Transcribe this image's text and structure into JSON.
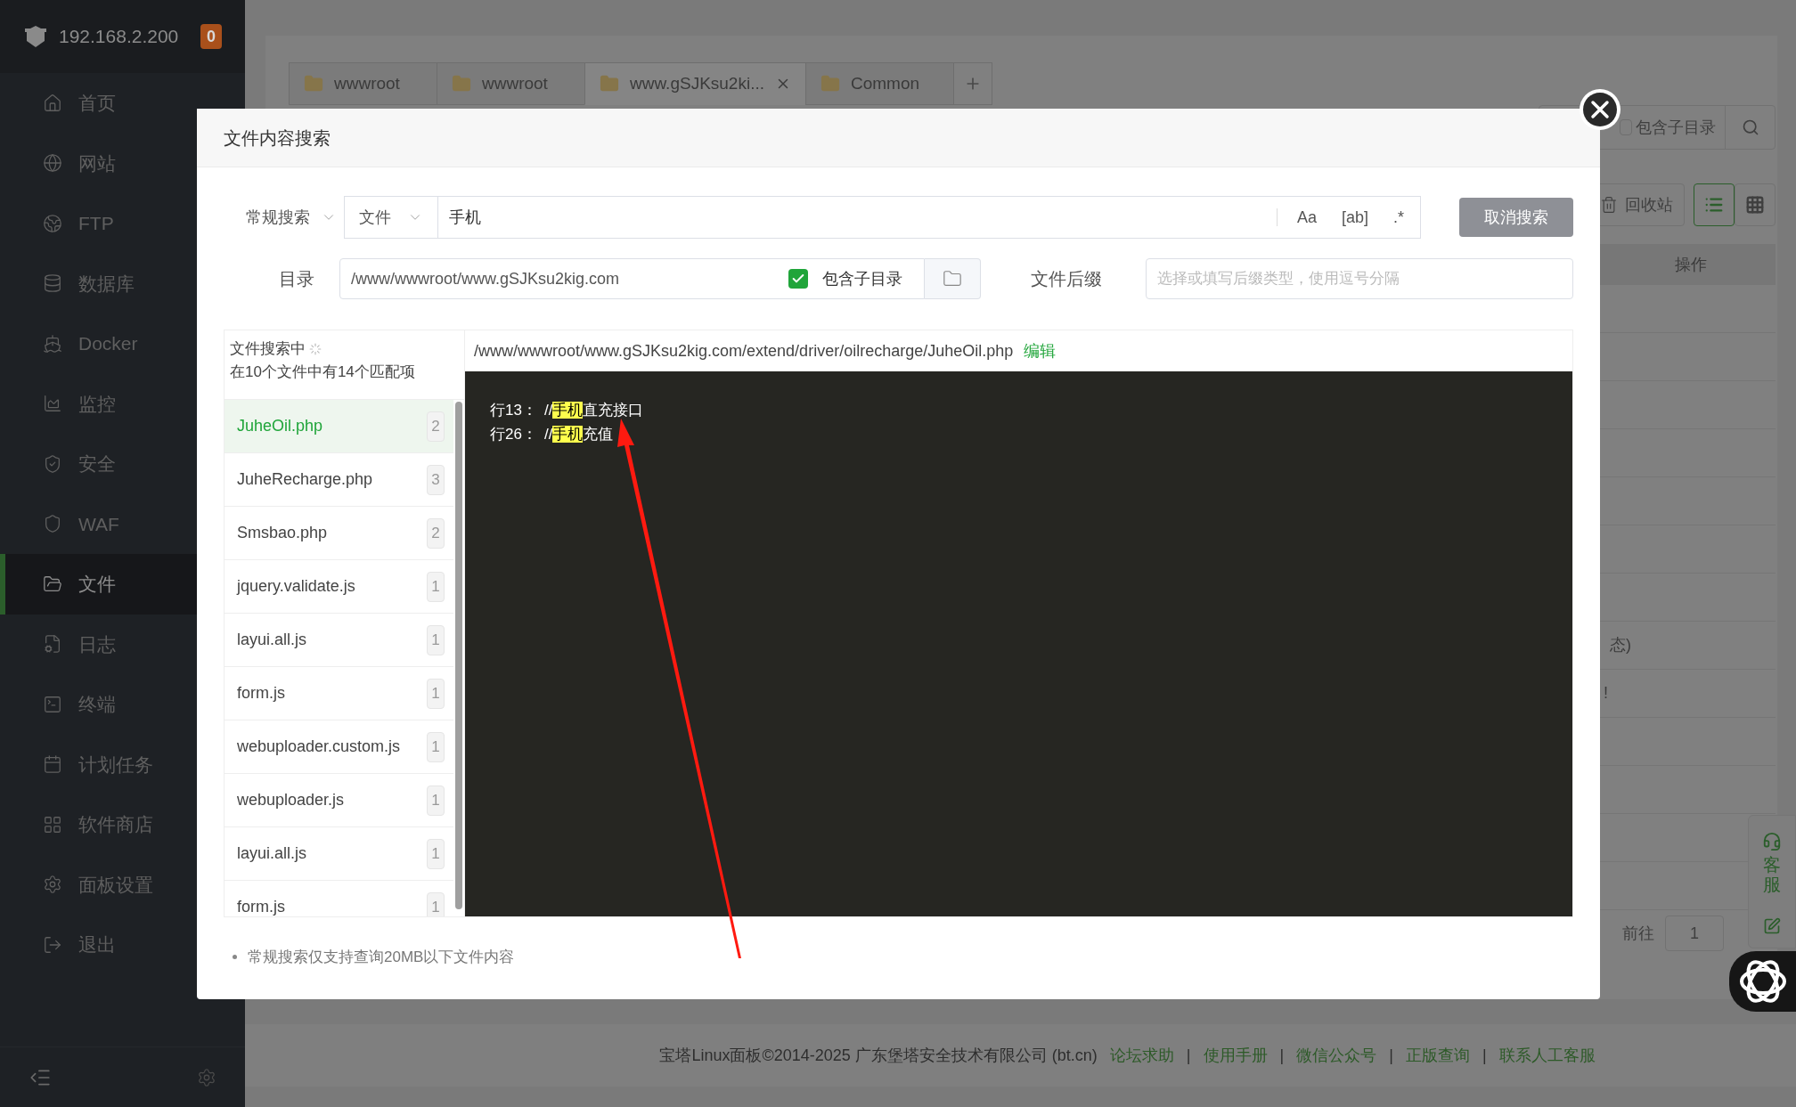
{
  "sidebar": {
    "host": "192.168.2.200",
    "badge": "0",
    "items": [
      {
        "label": "首页",
        "selected": false
      },
      {
        "label": "网站",
        "selected": false
      },
      {
        "label": "FTP",
        "selected": false
      },
      {
        "label": "数据库",
        "selected": false
      },
      {
        "label": "Docker",
        "selected": false
      },
      {
        "label": "监控",
        "selected": false
      },
      {
        "label": "安全",
        "selected": false
      },
      {
        "label": "WAF",
        "selected": false
      },
      {
        "label": "文件",
        "selected": true
      },
      {
        "label": "日志",
        "selected": false
      },
      {
        "label": "终端",
        "selected": false
      },
      {
        "label": "计划任务",
        "selected": false
      },
      {
        "label": "软件商店",
        "selected": false
      },
      {
        "label": "面板设置",
        "selected": false
      },
      {
        "label": "退出",
        "selected": false
      }
    ]
  },
  "tabs": [
    {
      "label": "wwwroot",
      "selected": false,
      "closable": false
    },
    {
      "label": "wwwroot",
      "selected": false,
      "closable": false
    },
    {
      "label": "www.gSJKsu2ki...",
      "selected": true,
      "closable": true
    },
    {
      "label": "Common",
      "selected": false,
      "closable": false
    }
  ],
  "toolbar": {
    "subdir_label": "包含子目录",
    "subdir_checked": false,
    "recycle_label": "回收站",
    "views": [
      {
        "kind": "list",
        "selected": true
      },
      {
        "kind": "grid",
        "selected": false
      }
    ]
  },
  "table": {
    "column_header": "操作",
    "fragments": [
      "态)",
      "!"
    ]
  },
  "pagination": {
    "goto_label": "前往",
    "page": "1"
  },
  "float_panel": {
    "label": "客服"
  },
  "footer": {
    "copyright": "宝塔Linux面板©2014-2025 广东堡塔安全技术有限公司 (bt.cn)",
    "links": [
      "论坛求助",
      "使用手册",
      "微信公众号",
      "正版查询",
      "联系人工客服"
    ],
    "separators": [
      "|",
      "|",
      "|",
      "|"
    ]
  },
  "dialog": {
    "title": "文件内容搜索",
    "mode": "常规搜索",
    "scope": "文件",
    "query": "手机",
    "options": [
      "Aa",
      "[ab]",
      ".*"
    ],
    "cancel_button": "取消搜索",
    "dir_label": "目录",
    "dir": "/www/wwwroot/www.gSJKsu2kig.com",
    "subdir_label": "包含子目录",
    "subdir_checked": true,
    "suffix_label": "文件后缀",
    "suffix_placeholder": "选择或填写后缀类型，使用逗号分隔",
    "status": "文件搜索中",
    "summary": "在10个文件中有14个匹配项",
    "files": [
      {
        "name": "JuheOil.php",
        "count": "2",
        "selected": true
      },
      {
        "name": "JuheRecharge.php",
        "count": "3",
        "selected": false
      },
      {
        "name": "Smsbao.php",
        "count": "2",
        "selected": false
      },
      {
        "name": "jquery.validate.js",
        "count": "1",
        "selected": false
      },
      {
        "name": "layui.all.js",
        "count": "1",
        "selected": false
      },
      {
        "name": "form.js",
        "count": "1",
        "selected": false
      },
      {
        "name": "webuploader.custom.js",
        "count": "1",
        "selected": false
      },
      {
        "name": "webuploader.js",
        "count": "1",
        "selected": false
      },
      {
        "name": "layui.all.js",
        "count": "1",
        "selected": false
      },
      {
        "name": "form.js",
        "count": "1",
        "selected": false
      }
    ],
    "preview": {
      "path": "/www/wwwroot/www.gSJKsu2kig.com/extend/driver/oilrecharge/JuheOil.php",
      "edit_link": "编辑",
      "lines": [
        {
          "label": "行13：",
          "prefix": "//",
          "match": "手机",
          "rest": "直充接口"
        },
        {
          "label": "行26：",
          "prefix": "//",
          "match": "手机",
          "rest": "充值"
        }
      ]
    },
    "note": "常规搜索仅支持查询20MB以下文件内容"
  }
}
